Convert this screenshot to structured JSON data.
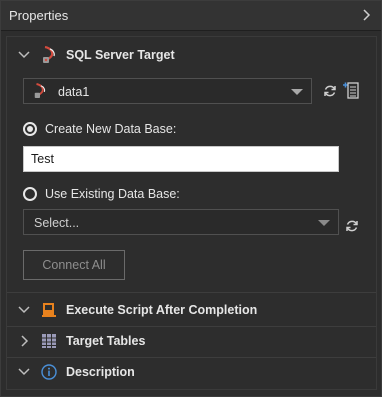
{
  "panel": {
    "title": "Properties"
  },
  "sections": {
    "sql_target": {
      "label": "SQL Server Target",
      "expanded": true
    },
    "execute_script": {
      "label": "Execute Script After Completion",
      "expanded": true
    },
    "target_tables": {
      "label": "Target Tables",
      "expanded": false
    },
    "description": {
      "label": "Description",
      "expanded": true
    }
  },
  "datasource": {
    "selected": "data1"
  },
  "create_new": {
    "label": "Create New Data Base:",
    "value": "Test",
    "selected": true
  },
  "use_existing": {
    "label": "Use Existing Data Base:",
    "placeholder": "Select...",
    "selected": false
  },
  "connect_button": {
    "label": "Connect All",
    "enabled": false
  },
  "colors": {
    "accent_orange": "#e8821e",
    "sql_red": "#c0392b",
    "info_blue": "#4a90d9"
  }
}
